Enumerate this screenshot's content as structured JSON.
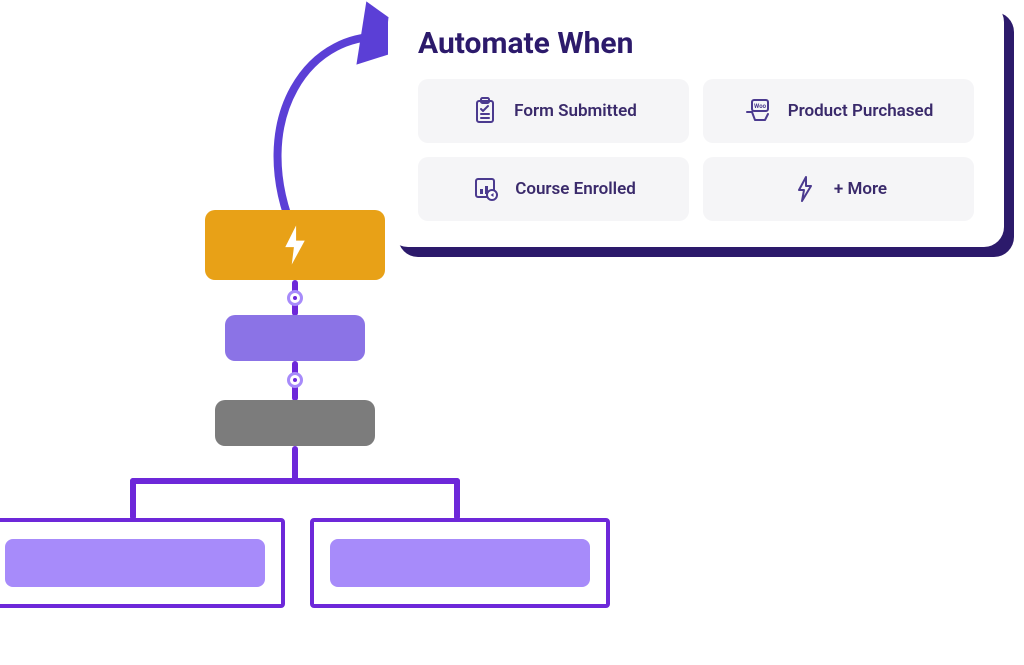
{
  "popup": {
    "title": "Automate When",
    "options": [
      {
        "icon": "clipboard-check-icon",
        "label": "Form Submitted"
      },
      {
        "icon": "cart-icon",
        "label": "Product Purchased"
      },
      {
        "icon": "course-icon",
        "label": "Course Enrolled"
      },
      {
        "icon": "bolt-icon",
        "label": "+ More"
      }
    ]
  },
  "colors": {
    "brand_dark": "#2c1a6b",
    "brand_purple": "#6d28d9",
    "brand_light_purple": "#a78bfa",
    "trigger_orange": "#e8a117",
    "step_gray": "#7c7c7c",
    "option_bg": "#f5f5f7"
  }
}
